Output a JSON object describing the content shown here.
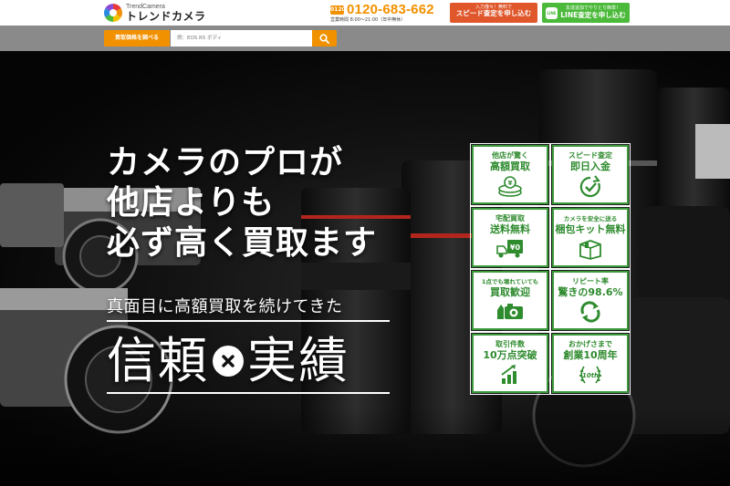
{
  "header": {
    "logo_sub": "TrendCamera",
    "logo_main": "トレンドカメラ",
    "phone_icon_label": "0120",
    "phone_number": "0120-683-662",
    "phone_hours": "営業時間 8:00～21:00（年中無休）",
    "speed_cta": {
      "small": "入力僅々！無料で",
      "large": "スピード査定を申し込む"
    },
    "line_cta": {
      "badge": "LINE",
      "small": "友達追加でやりとり簡単！",
      "large": "LINE査定を申し込む"
    }
  },
  "search": {
    "label": "買取価格を調べる",
    "placeholder": "例：EOS R5 ボディ",
    "icon": "search-icon"
  },
  "hero": {
    "headline": [
      "カメラのプロが",
      "他店よりも",
      "必ず高く買取ます"
    ],
    "lead": "真面目に高額買取を続けてきた",
    "trust_left": "信頼",
    "trust_right": "実績"
  },
  "features": [
    {
      "line1": "他店が驚く",
      "line2": "高額買取",
      "icon": "coins-icon"
    },
    {
      "line1": "スピード査定",
      "line2": "即日入金",
      "icon": "clock-check-icon"
    },
    {
      "line1": "宅配買取",
      "line2": "送料無料",
      "icon": "truck-icon"
    },
    {
      "line1": "カメラを安全に送る",
      "line2": "梱包キット無料",
      "icon": "box-icon"
    },
    {
      "line1": "1点でも壊れていても",
      "line2": "買取歓迎",
      "icon": "broken-camera-icon"
    },
    {
      "line1": "リピート率",
      "line2": "驚きの98.6%",
      "icon": "repeat-icon"
    },
    {
      "line1": "取引件数",
      "line2": "10万点突破",
      "icon": "growth-chart-icon"
    },
    {
      "line1": "おかげさまで",
      "line2": "創業10周年",
      "icon": "anniversary-laurel-icon"
    }
  ],
  "colors": {
    "accent": "#f29100",
    "cta_speed": "#e0572b",
    "line_green": "#4bb93a",
    "feature_green": "#2e8b2e"
  }
}
